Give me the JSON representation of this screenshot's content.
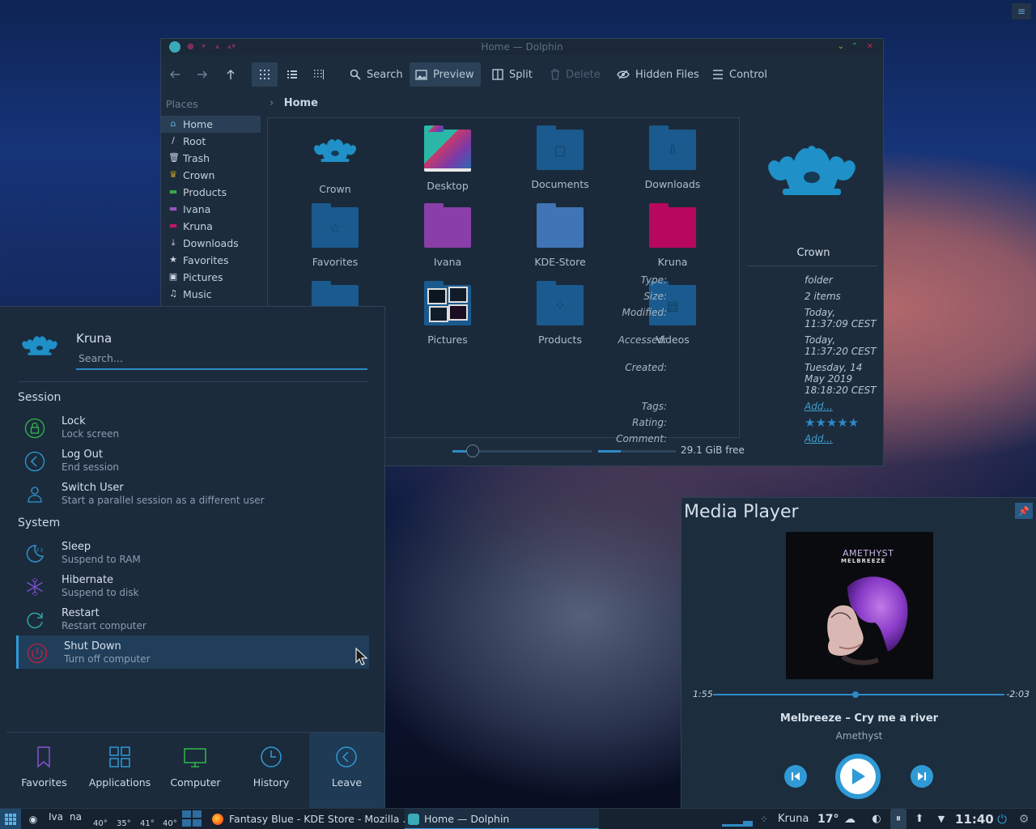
{
  "dolphin": {
    "title": "Home — Dolphin",
    "toolbar": {
      "search": "Search",
      "preview": "Preview",
      "split": "Split",
      "delete": "Delete",
      "hidden_files": "Hidden Files",
      "control": "Control"
    },
    "places_header": "Places",
    "places": [
      {
        "label": "Home",
        "icon": "home-icon",
        "color": "#5fb4e8"
      },
      {
        "label": "Root",
        "icon": "root-icon",
        "color": "#c9d6e3"
      },
      {
        "label": "Trash",
        "icon": "trash-icon",
        "color": "#c9d6e3"
      },
      {
        "label": "Crown",
        "icon": "crown-icon",
        "color": "#c8a028"
      },
      {
        "label": "Products",
        "icon": "folder-icon",
        "color": "#3aa64a"
      },
      {
        "label": "Ivana",
        "icon": "folder-icon",
        "color": "#9a54c0"
      },
      {
        "label": "Kruna",
        "icon": "folder-icon",
        "color": "#c01866"
      },
      {
        "label": "Downloads",
        "icon": "download-icon",
        "color": "#c9d6e3"
      },
      {
        "label": "Favorites",
        "icon": "star-icon",
        "color": "#c9d6e3"
      },
      {
        "label": "Pictures",
        "icon": "image-icon",
        "color": "#c9d6e3"
      },
      {
        "label": "Music",
        "icon": "music-icon",
        "color": "#c9d6e3"
      }
    ],
    "breadcrumb": "Home",
    "files": [
      {
        "name": "Crown",
        "kind": "crown"
      },
      {
        "name": "Desktop",
        "kind": "desktop"
      },
      {
        "name": "Documents",
        "kind": "folder",
        "color": "#1a5a8e",
        "glyph": "▢"
      },
      {
        "name": "Downloads",
        "kind": "folder",
        "color": "#1a5a8e",
        "glyph": "⇩"
      },
      {
        "name": "Favorites",
        "kind": "folder",
        "color": "#1a5a8e",
        "glyph": "☆"
      },
      {
        "name": "Ivana",
        "kind": "folder",
        "color": "#8a3ea8",
        "glyph": ""
      },
      {
        "name": "KDE-Store",
        "kind": "folder",
        "color": "#3f74b6",
        "glyph": ""
      },
      {
        "name": "Kruna",
        "kind": "folder",
        "color": "#b8085e",
        "glyph": ""
      },
      {
        "name": "",
        "kind": "folder",
        "color": "#1a5a8e",
        "glyph": ""
      },
      {
        "name": "Pictures",
        "kind": "pictures"
      },
      {
        "name": "Products",
        "kind": "folder",
        "color": "#1a5a8e",
        "glyph": "⁘"
      },
      {
        "name": "Videos",
        "kind": "folder",
        "color": "#1a5a8e",
        "glyph": "▤"
      }
    ],
    "info": {
      "name": "Crown",
      "type_label": "Type:",
      "type": "folder",
      "size_label": "Size:",
      "size": "2 items",
      "modified_label": "Modified:",
      "modified": "Today, 11:37:09 CEST",
      "accessed_label": "Accessed:",
      "accessed": "Today, 11:37:20 CEST",
      "created_label": "Created:",
      "created": "Tuesday, 14 May 2019 18:18:20 CEST",
      "tags_label": "Tags:",
      "tags": "Add...",
      "rating_label": "Rating:",
      "rating": 5,
      "comment_label": "Comment:",
      "comment": "Add..."
    },
    "free_space": "29.1 GiB free",
    "zoom_level": 0.12
  },
  "launcher": {
    "user": "Kruna",
    "search_placeholder": "Search...",
    "session_header": "Session",
    "system_header": "System",
    "session": [
      {
        "title": "Lock",
        "subtitle": "Lock screen",
        "icon": "lock-icon"
      },
      {
        "title": "Log Out",
        "subtitle": "End session",
        "icon": "logout-icon"
      },
      {
        "title": "Switch User",
        "subtitle": "Start a parallel session as a different user",
        "icon": "switch-user-icon"
      }
    ],
    "system": [
      {
        "title": "Sleep",
        "subtitle": "Suspend to RAM",
        "icon": "sleep-icon"
      },
      {
        "title": "Hibernate",
        "subtitle": "Suspend to disk",
        "icon": "hibernate-icon"
      },
      {
        "title": "Restart",
        "subtitle": "Restart computer",
        "icon": "restart-icon"
      },
      {
        "title": "Shut Down",
        "subtitle": "Turn off computer",
        "icon": "power-icon",
        "selected": true
      }
    ],
    "tabs": [
      {
        "label": "Favorites",
        "icon": "bookmark-icon",
        "color": "#8a4fd0"
      },
      {
        "label": "Applications",
        "icon": "grid-icon",
        "color": "#2f9ad6"
      },
      {
        "label": "Computer",
        "icon": "monitor-icon",
        "color": "#2fb84a"
      },
      {
        "label": "History",
        "icon": "clock-icon",
        "color": "#2f9ad6"
      },
      {
        "label": "Leave",
        "icon": "leave-icon",
        "color": "#2f9ad6",
        "selected": true
      }
    ]
  },
  "media": {
    "title": "Media Player",
    "album_artist": "MELBREEZE",
    "album_name": "AMETHYST",
    "elapsed": "1:55",
    "remaining": "-2:03",
    "progress": 0.49,
    "track": "Melbreeze – Cry me a river",
    "album": "Amethyst"
  },
  "taskbar": {
    "cpu_labels": [
      "Iva",
      "na"
    ],
    "temps": [
      "40°",
      "35°",
      "41°",
      "40°"
    ],
    "tasks": [
      {
        "label": "Fantasy Blue - KDE Store - Mozilla ...",
        "icon": "firefox-icon"
      },
      {
        "label": "Home — Dolphin",
        "icon": "dolphin-icon",
        "active": true
      }
    ],
    "user": "Kruna",
    "weather_temp": "17°",
    "clock": "11:40"
  },
  "colors": {
    "accent": "#2f9ad6",
    "crown": "#1f90c8"
  }
}
